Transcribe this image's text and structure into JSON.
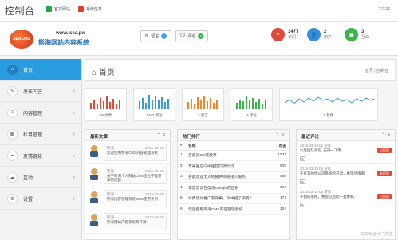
{
  "topbar": {
    "brand": "控制台",
    "links": [
      {
        "label": "官方网站",
        "color": "#27a64a"
      },
      {
        "label": "系统信息",
        "color": "#e04030"
      }
    ],
    "greeting": "下午好"
  },
  "header": {
    "logo_text": "SEACMS",
    "site_url": "www.isea.pw",
    "site_name": "熊海网站内容系统",
    "buttons": [
      {
        "label": "留言",
        "count": "1",
        "color": "#4aa3d8"
      },
      {
        "label": "评论",
        "count": "6",
        "color": "#3ab54a"
      }
    ],
    "stats": [
      {
        "value": "3477",
        "label": "访问",
        "color": "#e04a3a",
        "icon": "heart-icon"
      },
      {
        "value": "2",
        "label": "用户",
        "color": "#3a8ed6",
        "icon": "user-icon"
      },
      {
        "value": "3",
        "label": "互动",
        "color": "#3ab54a",
        "icon": "chat-icon"
      }
    ]
  },
  "sidebar": {
    "items": [
      {
        "label": "首页",
        "icon": "home-icon",
        "active": true
      },
      {
        "label": "发布内容",
        "icon": "pencil-icon"
      },
      {
        "label": "内容管理",
        "icon": "list-icon"
      },
      {
        "label": "栏目管理",
        "icon": "grid-icon"
      },
      {
        "label": "友情链接",
        "icon": "link-icon"
      },
      {
        "label": "互动",
        "icon": "chat-icon"
      },
      {
        "label": "设置",
        "icon": "gear-icon"
      }
    ]
  },
  "page": {
    "title": "首页",
    "crumbs": "首页 / 控制台"
  },
  "tiles": [
    {
      "label": "10 文章",
      "color": "#e04a3a"
    },
    {
      "label": "3477 浏览",
      "color": "#3a9ad6"
    },
    {
      "label": "2 留言",
      "color": "#f0852a"
    },
    {
      "label": "2 评论",
      "color": "#3ab54a"
    },
    {
      "label": "1 软件",
      "color": "#3a9ad6"
    }
  ],
  "news": {
    "title": "最新文章",
    "items": [
      {
        "who": "熊海",
        "date": "2015-03-17",
        "text": "欢迎使用熊海CMS内容管理系统"
      },
      {
        "who": "熊海",
        "date": "2015-03-16",
        "text": "关于熊海个人网站CMS后台不能登录的问题"
      },
      {
        "who": "熊海",
        "date": "2015-03-16",
        "text": "熊海内容管理系统CMS使用手册"
      },
      {
        "who": "熊海",
        "date": "2015-03-15",
        "text": "熊海网站内容系统和开源"
      }
    ]
  },
  "hot": {
    "title": "热门排行",
    "col_rank": "#",
    "col_name": "名称",
    "col_clicks": "点击",
    "rows": [
      {
        "rank": "1",
        "name": "百度云OS被放弃",
        "clicks": "1031"
      },
      {
        "rank": "2",
        "name": "苹果回应向中国提交源代码",
        "clicks": "609"
      },
      {
        "rank": "3",
        "name": "谷歌欢迎无人机播供网络接入服务",
        "clicks": "488"
      },
      {
        "rank": "4",
        "name": "李彦宏谈百度与Google的区别",
        "clicks": "397"
      },
      {
        "rank": "5",
        "name": "付费软文推广有效果，你中招了没有？",
        "clicks": "177"
      },
      {
        "rank": "6",
        "name": "欢迎使用熊海CMS内容管理系统",
        "clicks": "104"
      }
    ]
  },
  "comments": {
    "title": "最近评论",
    "items": [
      {
        "meta": "2015-03-19 by 游客",
        "text": "以后团队外包, 支持一下啊。",
        "tag": "已回复",
        "tag_color": "#e04a3a"
      },
      {
        "meta": "2015-03-19 by 游客",
        "text": "正在等待你公司系统的开源，希望尽快啊!",
        "tag": "未回复",
        "tag_color": "#e04a3a"
      },
      {
        "meta": "2015-03-19 by 游客",
        "text": "不错的系统，希望以后能一直更新。",
        "tag": "已回复",
        "tag_color": "#e04a3a"
      }
    ]
  },
  "watermark": "CSDN @大飞先生"
}
